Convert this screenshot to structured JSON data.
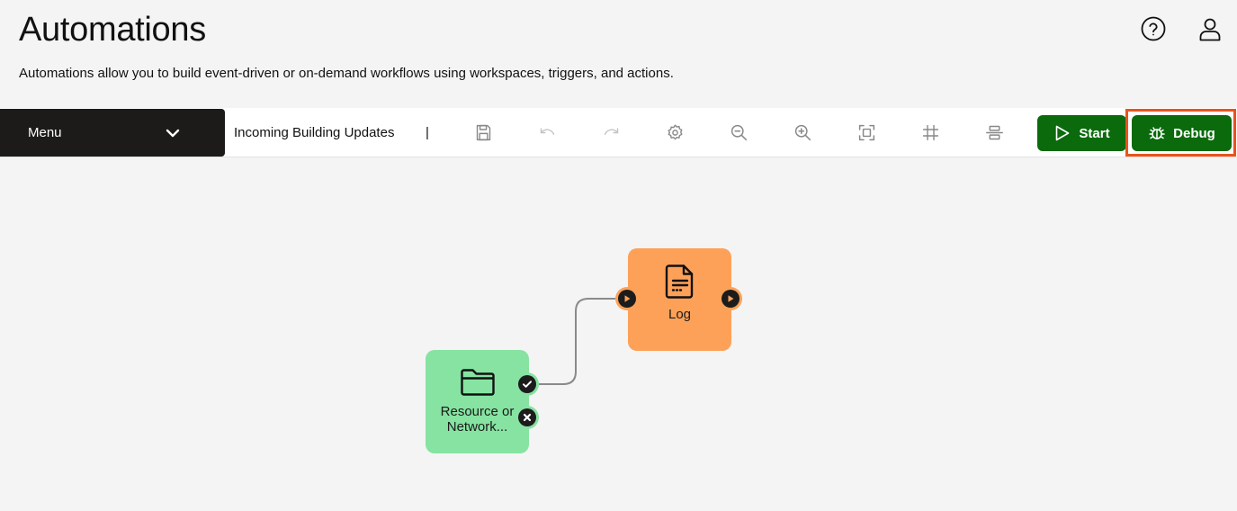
{
  "header": {
    "title": "Automations",
    "description": "Automations allow you to build event-driven or on-demand workflows using workspaces, triggers, and actions.",
    "icons": {
      "help": "help-circle-icon",
      "user": "user-icon"
    }
  },
  "toolbar": {
    "menu_label": "Menu",
    "workflow_name": "Incoming Building Updates",
    "separator": "|",
    "tools": [
      {
        "name": "save-icon"
      },
      {
        "name": "undo-icon"
      },
      {
        "name": "redo-icon"
      },
      {
        "name": "settings-icon"
      },
      {
        "name": "zoom-out-icon"
      },
      {
        "name": "zoom-in-icon"
      },
      {
        "name": "fit-screen-icon"
      },
      {
        "name": "grid-icon"
      },
      {
        "name": "align-icon"
      }
    ],
    "start_label": "Start",
    "debug_label": "Debug"
  },
  "canvas": {
    "nodes": [
      {
        "id": "resource",
        "label_line1": "Resource or",
        "label_line2": "Network...",
        "icon": "folder-icon",
        "color": "#86e3a1"
      },
      {
        "id": "log",
        "label": "Log",
        "icon": "document-icon",
        "color": "#fea158"
      }
    ]
  },
  "colors": {
    "primary_green": "#0a6a0c",
    "highlight": "#e8541c",
    "menu_bg": "#1c1b1a"
  }
}
